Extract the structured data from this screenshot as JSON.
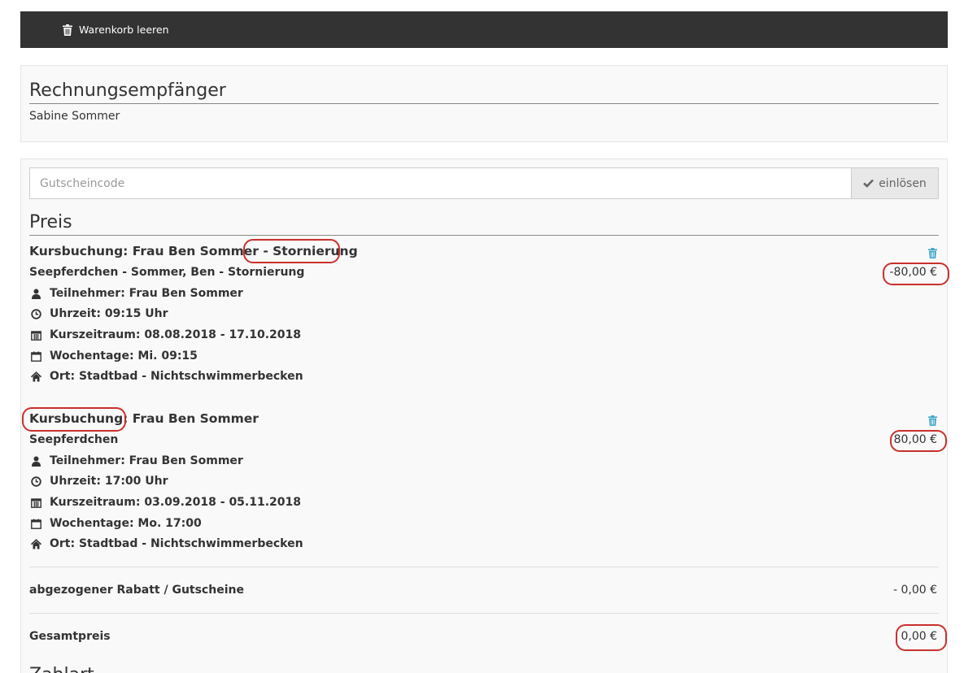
{
  "topbar": {
    "clear_cart_label": "Warenkorb leeren"
  },
  "recipient": {
    "title": "Rechnungsempfänger",
    "name": "Sabine Sommer"
  },
  "voucher": {
    "placeholder": "Gutscheincode",
    "value": "",
    "redeem_label": "einlösen"
  },
  "price": {
    "title": "Preis",
    "items": [
      {
        "title_main": "Kursbuchung: Frau Ben Sommer ",
        "title_suffix": "- Stornierung",
        "subtitle": "Seepferdchen - Sommer, Ben - Stornierung",
        "amount": "-80,00 €",
        "participant": "Teilnehmer: Frau Ben Sommer",
        "time": "Uhrzeit: 09:15 Uhr",
        "period": "Kurszeitraum: 08.08.2018 - 17.10.2018",
        "weekdays": "Wochentage: Mi. 09:15",
        "location": "Ort: Stadtbad - Nichtschwimmerbecken"
      },
      {
        "title_main": "Kursbuchung: Frau Ben Sommer",
        "title_suffix": "",
        "subtitle": "Seepferdchen",
        "amount": "80,00 €",
        "participant": "Teilnehmer: Frau Ben Sommer",
        "time": "Uhrzeit: 17:00 Uhr",
        "period": "Kurszeitraum: 03.09.2018 - 05.11.2018",
        "weekdays": "Wochentage: Mo. 17:00",
        "location": "Ort: Stadtbad - Nichtschwimmerbecken"
      }
    ],
    "discount_label": "abgezogener Rabatt / Gutscheine",
    "discount_value": "- 0,00 €",
    "total_label": "Gesamtpreis",
    "total_value": "0,00 €"
  },
  "payment": {
    "title": "Zahlart"
  },
  "colors": {
    "topbar": "#333333",
    "trash_icon": "#31a1c7",
    "highlight": "#c9302c"
  },
  "icons": [
    "trash-icon",
    "check-icon",
    "user-icon",
    "clock-icon",
    "calendar-icon",
    "calendar-empty-icon",
    "home-icon"
  ]
}
